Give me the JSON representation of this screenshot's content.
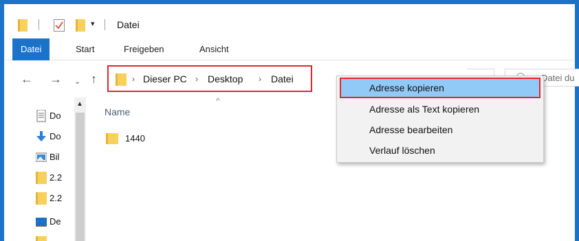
{
  "window": {
    "title": "Datei",
    "accent_color": "#1a73c9",
    "quick_access_dropdown": "▾"
  },
  "ribbon": {
    "tabs": [
      {
        "label": "Datei",
        "active": true
      },
      {
        "label": "Start",
        "active": false
      },
      {
        "label": "Freigeben",
        "active": false
      },
      {
        "label": "Ansicht",
        "active": false
      }
    ]
  },
  "nav": {
    "back": "←",
    "forward": "→",
    "recent": "⌄",
    "up": "↑"
  },
  "address": {
    "segments": [
      "Dieser PC",
      "Desktop",
      "Datei"
    ],
    "separator": "›",
    "highlight_color": "#e3262a"
  },
  "search": {
    "placeholder": "Datei du"
  },
  "nav_pane": {
    "items": [
      {
        "label": "Do",
        "icon": "document-icon"
      },
      {
        "label": "Do",
        "icon": "download-icon"
      },
      {
        "label": "Bil",
        "icon": "pictures-icon"
      },
      {
        "label": "2.2",
        "icon": "folder-icon"
      },
      {
        "label": "2.2",
        "icon": "folder-icon"
      },
      {
        "label": "De",
        "icon": "desktop-icon"
      }
    ]
  },
  "content": {
    "column_header": "Name",
    "sort_indicator": "^",
    "files": [
      {
        "name": "1440",
        "icon": "folder-icon"
      }
    ]
  },
  "context_menu": {
    "items": [
      {
        "label": "Adresse kopieren",
        "highlighted": true
      },
      {
        "label": "Adresse als Text kopieren",
        "highlighted": false
      },
      {
        "label": "Adresse bearbeiten",
        "highlighted": false
      },
      {
        "label": "Verlauf löschen",
        "highlighted": false
      }
    ],
    "hover_color": "#91c9f7"
  }
}
